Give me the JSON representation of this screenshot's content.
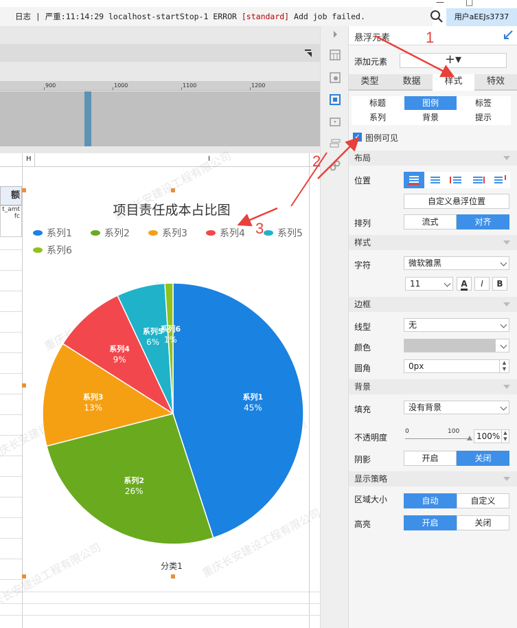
{
  "window": {
    "caption_buttons": [
      "—",
      "□"
    ],
    "log_text_prefix": "日志 | 严重:11:14:29 localhost-startStop-1 ERROR ",
    "log_text_level": "[standard]",
    "log_text_suffix": " Add job failed.",
    "user_label": "用户aEEJs3737"
  },
  "ruler": {
    "ticks": [
      "900",
      "1000",
      "1100",
      "1200"
    ]
  },
  "sheet": {
    "col_headers": [
      "H",
      "I"
    ],
    "cell_header_fragment": "额",
    "cell_fragment_line1": "t_amt",
    "cell_fragment_line2": "fc"
  },
  "chart_data": {
    "type": "pie",
    "title": "项目责任成本占比图",
    "category": "分类1",
    "legend_position": "top",
    "series": [
      {
        "name": "系列1",
        "value": 45,
        "label": "45%",
        "color": "#1a82e0"
      },
      {
        "name": "系列2",
        "value": 26,
        "label": "26%",
        "color": "#6aaa1e"
      },
      {
        "name": "系列3",
        "value": 13,
        "label": "13%",
        "color": "#f5a013"
      },
      {
        "name": "系列4",
        "value": 9,
        "label": "9%",
        "color": "#f2474c"
      },
      {
        "name": "系列5",
        "value": 6,
        "label": "6%",
        "color": "#1fb2c9"
      },
      {
        "name": "系列6",
        "value": 1,
        "label": "1%",
        "color": "#8ec21f"
      }
    ]
  },
  "watermark": "重庆长安建设工程有限公司",
  "panel": {
    "title": "悬浮元素",
    "add_element_label": "添加元素",
    "add_element_button": "+▾",
    "tabs": [
      "类型",
      "数据",
      "样式",
      "特效"
    ],
    "active_tab": "样式",
    "subtabs": [
      "标题",
      "图例",
      "标签",
      "系列",
      "背景",
      "提示"
    ],
    "active_subtab": "图例",
    "legend_visible_label": "图例可见",
    "legend_visible": true,
    "layout_section": "布局",
    "position_label": "位置",
    "custom_float_position": "自定义悬浮位置",
    "arrange_label": "排列",
    "arrange_options": [
      "流式",
      "对齐"
    ],
    "arrange_selected": "对齐",
    "style_section": "样式",
    "font_label": "字符",
    "font_value": "微软雅黑",
    "font_size": "11",
    "bold_button": "B",
    "italic_button": "I",
    "color_button": "A",
    "border_section": "边框",
    "line_type_label": "线型",
    "line_type_value": "无",
    "color_label": "颜色",
    "radius_label": "圆角",
    "radius_value": "0px",
    "background_section": "背景",
    "fill_label": "填充",
    "fill_value": "没有背景",
    "opacity_label": "不透明度",
    "opacity_min": "0",
    "opacity_max": "100",
    "opacity_value": "100%",
    "shadow_label": "阴影",
    "shadow_options": [
      "开启",
      "关闭"
    ],
    "shadow_selected": "关闭",
    "display_section": "显示策略",
    "area_size_label": "区域大小",
    "area_size_options": [
      "自动",
      "自定义"
    ],
    "area_size_selected": "自动",
    "highlight_label": "高亮",
    "highlight_options": [
      "开启",
      "关闭"
    ],
    "highlight_selected": "开启"
  },
  "annotations": [
    "1",
    "2",
    "3"
  ],
  "colors": {
    "accent": "#3d8fe8",
    "annotation": "#e8403a"
  }
}
